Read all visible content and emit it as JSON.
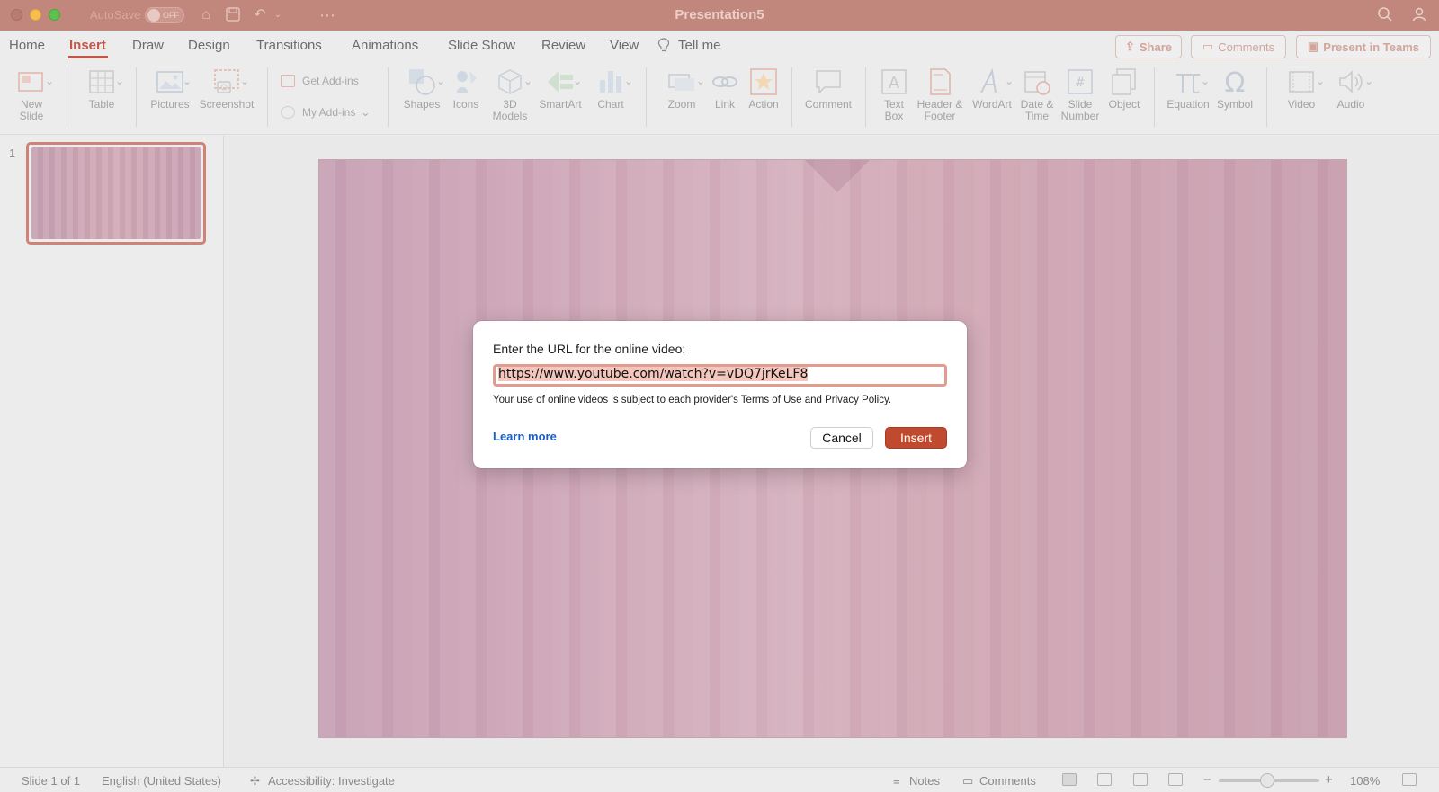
{
  "window": {
    "title": "Presentation5",
    "autosave_label": "AutoSave",
    "autosave_state": "OFF"
  },
  "ribbon_tabs": [
    {
      "label": "Home"
    },
    {
      "label": "Insert",
      "active": true
    },
    {
      "label": "Draw"
    },
    {
      "label": "Design"
    },
    {
      "label": "Transitions"
    },
    {
      "label": "Animations"
    },
    {
      "label": "Slide Show"
    },
    {
      "label": "Review"
    },
    {
      "label": "View"
    },
    {
      "label": "Tell me"
    }
  ],
  "header_buttons": {
    "share": "Share",
    "comments": "Comments",
    "present_in_teams": "Present in Teams"
  },
  "ribbon": {
    "new_slide": "New\nSlide",
    "table": "Table",
    "pictures": "Pictures",
    "screenshot": "Screenshot",
    "get_addins": "Get Add-ins",
    "my_addins": "My Add-ins",
    "shapes": "Shapes",
    "icons": "Icons",
    "models_3d": "3D\nModels",
    "smartart": "SmartArt",
    "chart": "Chart",
    "zoom": "Zoom",
    "link": "Link",
    "action": "Action",
    "comment": "Comment",
    "text_box": "Text\nBox",
    "header_footer": "Header &\nFooter",
    "wordart": "WordArt",
    "date_time": "Date &\nTime",
    "slide_number": "Slide\nNumber",
    "object": "Object",
    "equation": "Equation",
    "symbol": "Symbol",
    "video": "Video",
    "audio": "Audio"
  },
  "thumbnails": {
    "slide_number": "1"
  },
  "dialog": {
    "prompt": "Enter the URL for the online video:",
    "url_value": "https://www.youtube.com/watch?v=vDQ7jrKeLF8",
    "terms_note": "Your use of online videos is subject to each provider's Terms of Use and Privacy Policy.",
    "learn_more": "Learn more",
    "cancel_label": "Cancel",
    "insert_label": "Insert"
  },
  "status_bar": {
    "slide_info": "Slide 1 of 1",
    "language": "English (United States)",
    "accessibility": "Accessibility: Investigate",
    "notes": "Notes",
    "comments": "Comments",
    "zoom_minus": "−",
    "zoom_plus": "+",
    "zoom_level": "108%"
  },
  "colors": {
    "accent": "#c0574a",
    "titlebar": "#c1877c",
    "insert_button": "#bf4a2e",
    "link": "#1a5ec8"
  }
}
